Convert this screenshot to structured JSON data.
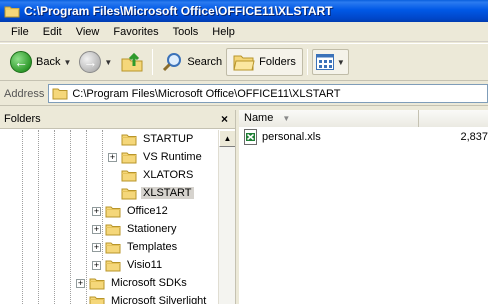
{
  "window": {
    "title": "C:\\Program Files\\Microsoft Office\\OFFICE11\\XLSTART"
  },
  "menu": [
    "File",
    "Edit",
    "View",
    "Favorites",
    "Tools",
    "Help"
  ],
  "toolbar": {
    "back_label": "Back",
    "search_label": "Search",
    "folders_label": "Folders"
  },
  "address": {
    "label": "Address",
    "value": "C:\\Program Files\\Microsoft Office\\OFFICE11\\XLSTART"
  },
  "folders_pane": {
    "title": "Folders",
    "close_label": "×",
    "items": [
      {
        "label": "STARTUP",
        "expandable": false,
        "selected": false
      },
      {
        "label": "VS Runtime",
        "expandable": true,
        "selected": false
      },
      {
        "label": "XLATORS",
        "expandable": false,
        "selected": false
      },
      {
        "label": "XLSTART",
        "expandable": false,
        "selected": true
      },
      {
        "label": "Office12",
        "expandable": true,
        "selected": false
      },
      {
        "label": "Stationery",
        "expandable": true,
        "selected": false
      },
      {
        "label": "Templates",
        "expandable": true,
        "selected": false
      },
      {
        "label": "Visio11",
        "expandable": true,
        "selected": false
      },
      {
        "label": "Microsoft SDKs",
        "expandable": true,
        "selected": false
      },
      {
        "label": "Microsoft Silverlight",
        "expandable": false,
        "selected": false
      }
    ]
  },
  "file_list": {
    "columns": [
      "Name"
    ],
    "sort_indicator": "▼",
    "files": [
      {
        "name": "personal.xls",
        "size": "2,837"
      }
    ]
  },
  "colors": {
    "title_bar": "#0058e6",
    "folder": "#f5d77a",
    "excel_green": "#1e7e34"
  }
}
